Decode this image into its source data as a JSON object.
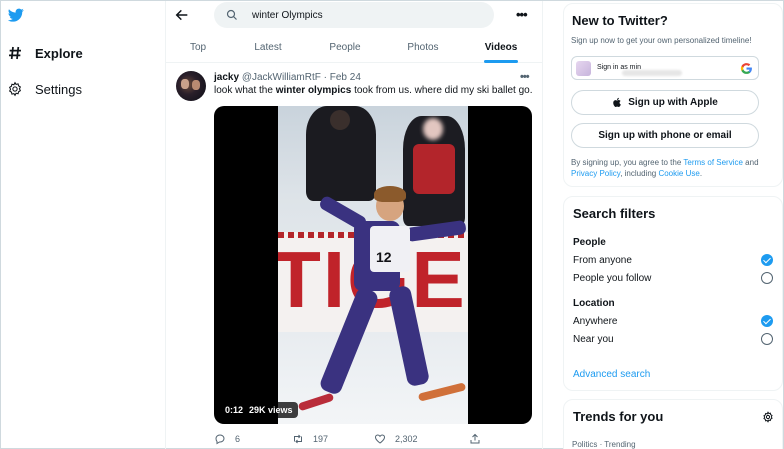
{
  "nav": {
    "explore_label": "Explore",
    "settings_label": "Settings"
  },
  "search": {
    "query": "winter Olympics"
  },
  "tabs": [
    {
      "label": "Top",
      "active": false
    },
    {
      "label": "Latest",
      "active": false
    },
    {
      "label": "People",
      "active": false
    },
    {
      "label": "Photos",
      "active": false
    },
    {
      "label": "Videos",
      "active": true
    }
  ],
  "tweet": {
    "name": "jacky",
    "handle": "@JackWilliamRtF",
    "date": "Feb 24",
    "text_before": "look what the ",
    "text_bold": "winter olympics",
    "text_after": " took from us. where did my ski ballet go.",
    "video": {
      "duration": "0:12",
      "views": "29K views",
      "bib_number": "12",
      "banner_text": "TIGE"
    },
    "replies": "6",
    "retweets": "197",
    "likes": "2,302"
  },
  "new_to_twitter": {
    "title": "New to Twitter?",
    "subtitle": "Sign up now to get your own personalized timeline!",
    "signed_in_label": "Sign in as min",
    "apple_button": "Sign up with Apple",
    "phone_button": "Sign up with phone or email",
    "terms_prefix": "By signing up, you agree to the ",
    "terms_link": "Terms of Service",
    "terms_and": " and ",
    "privacy_link": "Privacy Policy",
    "terms_including": ", including ",
    "cookie_link": "Cookie Use",
    "terms_end": "."
  },
  "filters": {
    "title": "Search filters",
    "people_heading": "People",
    "people_options": [
      {
        "label": "From anyone",
        "selected": true
      },
      {
        "label": "People you follow",
        "selected": false
      }
    ],
    "location_heading": "Location",
    "location_options": [
      {
        "label": "Anywhere",
        "selected": true
      },
      {
        "label": "Near you",
        "selected": false
      }
    ],
    "advanced_link": "Advanced search"
  },
  "trends": {
    "title": "Trends for you",
    "first_meta": "Politics · Trending"
  },
  "colors": {
    "accent": "#1d9bf0",
    "text": "#0f1419",
    "muted": "#536471"
  }
}
